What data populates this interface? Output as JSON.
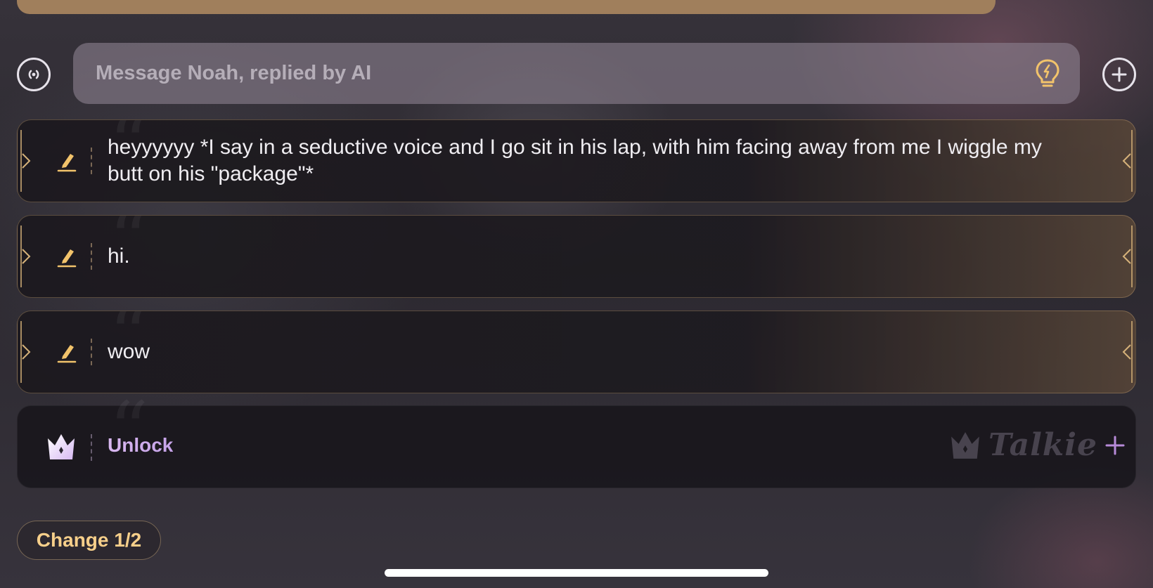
{
  "composer": {
    "placeholder": "Message Noah, replied by AI"
  },
  "messages": [
    {
      "text": "heyyyyyy *I say in a seductive voice and I go sit in his lap, with him facing away from me I wiggle my butt on his \"package\"*"
    },
    {
      "text": "hi."
    },
    {
      "text": "wow"
    }
  ],
  "unlock": {
    "label": "Unlock",
    "brand": "Talkie"
  },
  "change_button": {
    "label": "Change 1/2"
  },
  "icons": {
    "voice": "voice-call-icon",
    "add": "plus-circle-icon",
    "hint": "lightbulb-icon",
    "edit": "pencil-icon",
    "crown": "crown-icon"
  },
  "colors": {
    "accent_gold": "#f6cf8a",
    "unlock_purple": "#d9b8f0",
    "card_border": "#cdaa78"
  }
}
